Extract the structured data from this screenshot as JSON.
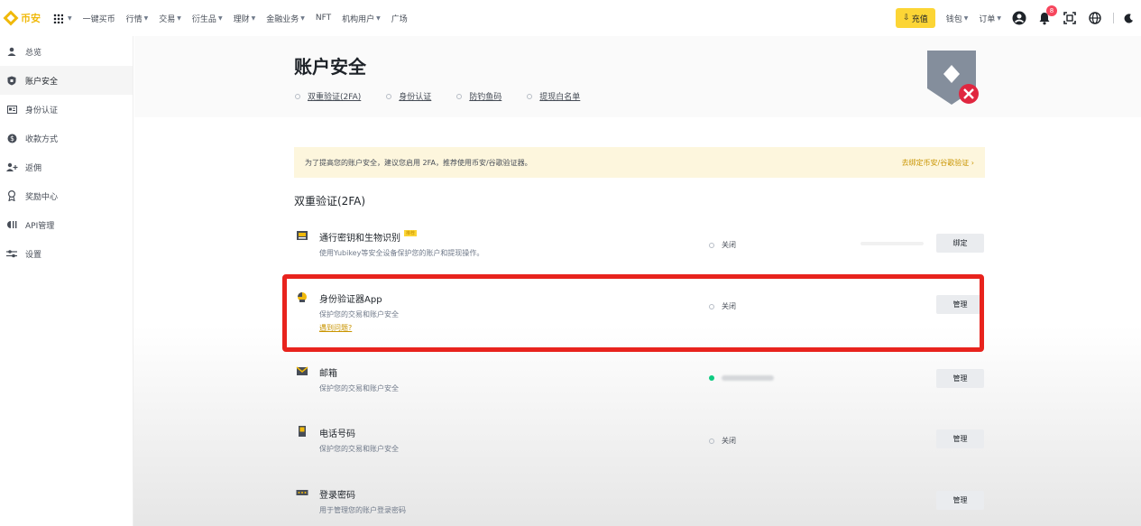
{
  "nav": {
    "logo": "币安",
    "items": [
      "一键买币",
      "行情",
      "交易",
      "衍生品",
      "理财",
      "金融业务",
      "NFT",
      "机构用户",
      "广场"
    ],
    "deposit": "充值",
    "wallet": "钱包",
    "orders": "订单",
    "notification_count": "8"
  },
  "sidebar": {
    "items": [
      {
        "label": "总览",
        "icon": "user-icon"
      },
      {
        "label": "账户安全",
        "icon": "shield-icon"
      },
      {
        "label": "身份认证",
        "icon": "id-card-icon"
      },
      {
        "label": "收款方式",
        "icon": "dollar-icon"
      },
      {
        "label": "返佣",
        "icon": "add-user-icon"
      },
      {
        "label": "奖励中心",
        "icon": "medal-icon"
      },
      {
        "label": "API管理",
        "icon": "api-icon"
      },
      {
        "label": "设置",
        "icon": "sliders-icon"
      }
    ],
    "active_index": 1
  },
  "page": {
    "title": "账户安全",
    "tabs": [
      "双重验证(2FA)",
      "身份认证",
      "防钓鱼码",
      "提现白名单"
    ]
  },
  "banner": {
    "text": "为了提高您的账户安全，建议您启用 2FA，推荐使用币安/谷歌验证器。",
    "link": "去绑定币安/谷歌验证 ›"
  },
  "section": {
    "title": "双重验证(2FA)",
    "rows": [
      {
        "title": "通行密钥和生物识别",
        "tag": "推荐",
        "desc": "使用Yubikey等安全设备保护您的账户和提现操作。",
        "status": "关闭",
        "button": "绑定",
        "icon": "passkey-icon"
      },
      {
        "title": "身份验证器App",
        "desc": "保护您的交易和账户安全",
        "link": "遇到问题?",
        "status": "关闭",
        "button": "管理",
        "icon": "authenticator-icon"
      },
      {
        "title": "邮箱",
        "desc": "保护您的交易和账户安全",
        "status": "",
        "status_ok": true,
        "button": "管理",
        "icon": "mail-icon"
      },
      {
        "title": "电话号码",
        "desc": "保护您的交易和账户安全",
        "status": "关闭",
        "button": "管理",
        "icon": "phone-icon"
      },
      {
        "title": "登录密码",
        "desc": "用于管理您的账户登录密码",
        "button": "管理",
        "icon": "password-icon"
      }
    ]
  },
  "colors": {
    "brand": "#f0b90b",
    "highlight": "#e8231d",
    "banner_bg": "#fdf6dd",
    "success": "#0ecb81"
  }
}
